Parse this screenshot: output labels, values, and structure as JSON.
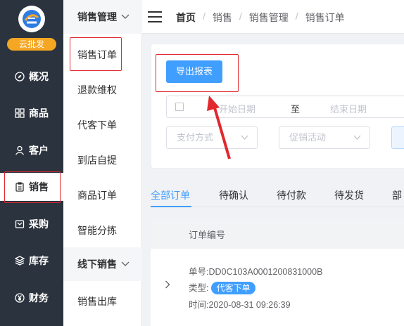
{
  "app": {
    "badge": "云批发"
  },
  "nav1": {
    "items": [
      {
        "label": "概况",
        "icon": "compass-icon"
      },
      {
        "label": "商品",
        "icon": "grid-icon"
      },
      {
        "label": "客户",
        "icon": "user-icon"
      },
      {
        "label": "销售",
        "icon": "clipboard-icon"
      },
      {
        "label": "采购",
        "icon": "cart-icon"
      },
      {
        "label": "库存",
        "icon": "layers-icon"
      },
      {
        "label": "财务",
        "icon": "yen-icon"
      }
    ],
    "active": "销售"
  },
  "nav2": {
    "group1": "销售管理",
    "items1": [
      "销售订单",
      "退款维权",
      "代客下单",
      "到店自提",
      "商品订单",
      "智能分拣"
    ],
    "group2": "线下销售",
    "items2": [
      "销售出库"
    ],
    "active": "销售订单"
  },
  "header": {
    "breadcrumb": [
      "首页",
      "销售",
      "销售管理",
      "销售订单"
    ]
  },
  "filters": {
    "export_label": "导出报表",
    "start_placeholder": "开始日期",
    "range_sep": "至",
    "end_placeholder": "结束日期",
    "pay_placeholder": "支付方式",
    "promo_placeholder": "促销活动"
  },
  "tabs": [
    "全部订单",
    "待确认",
    "待付款",
    "待发货",
    "部"
  ],
  "table": {
    "header": "订单编号",
    "rows": [
      {
        "order_no": "单号:DD0C103A0001200831000B",
        "type_label": "类型:",
        "type_tag": "代客下单",
        "time": "时间:2020-08-31 09:26:39"
      }
    ]
  },
  "colors": {
    "primary": "#409eff",
    "sidebar": "#2b333e",
    "highlight": "#e0282e",
    "badge": "#f5a623"
  }
}
